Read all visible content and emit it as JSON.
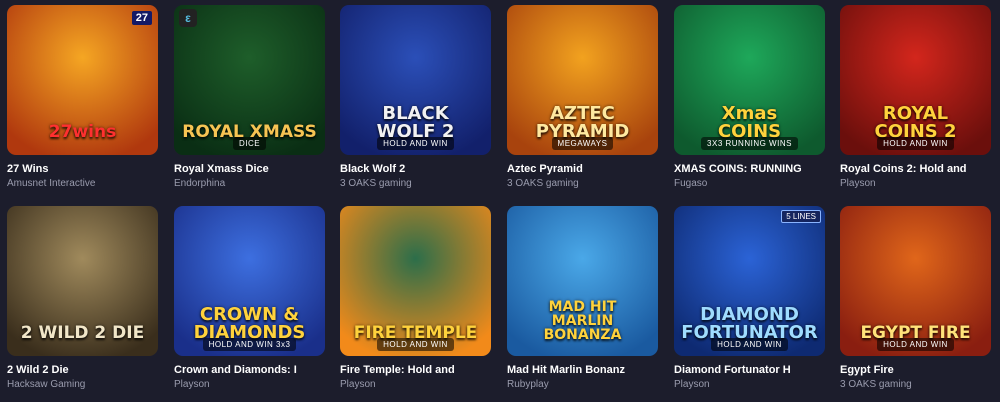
{
  "games": [
    {
      "id": "27wins",
      "title": "27 Wins",
      "provider": "Amusnet Interactive",
      "logo": "27wins",
      "sub": "",
      "badge": "27",
      "colors": [
        "#f5a623",
        "#b0380e"
      ],
      "logo_color": "#ff3030"
    },
    {
      "id": "royal-xmass-dice",
      "title": "Royal Xmass Dice",
      "provider": "Endorphina",
      "logo": "ROYAL XMASS",
      "sub": "DICE",
      "colors": [
        "#1e5e2a",
        "#0a2e14"
      ],
      "logo_color": "#f6c453"
    },
    {
      "id": "black-wolf-2",
      "title": "Black Wolf 2",
      "provider": "3 OAKS gaming",
      "logo": "BLACK\nWOLF 2",
      "sub": "HOLD AND WIN",
      "colors": [
        "#2b4fb8",
        "#12206b"
      ],
      "logo_color": "#f2f2f2"
    },
    {
      "id": "aztec-pyramid",
      "title": "Aztec Pyramid",
      "provider": "3 OAKS gaming",
      "logo": "AZTEC\nPYRAMID",
      "sub": "MEGAWAYS",
      "colors": [
        "#f2a21f",
        "#a8430d"
      ],
      "logo_color": "#ffe9a0"
    },
    {
      "id": "xmas-coins",
      "title": "XMAS COINS: RUNNING",
      "provider": "Fugaso",
      "logo": "Xmas\nCOINS",
      "sub": "3X3 RUNNING WINS",
      "colors": [
        "#1ea85a",
        "#0e5a2e"
      ],
      "logo_color": "#ffd23c"
    },
    {
      "id": "royal-coins-2",
      "title": "Royal Coins 2: Hold and",
      "provider": "Playson",
      "logo": "ROYAL\nCOINS 2",
      "sub": "HOLD AND WIN",
      "colors": [
        "#d3261c",
        "#6b0f0c"
      ],
      "logo_color": "#ffd23c"
    },
    {
      "id": "2-wild-2-die",
      "title": "2 Wild 2 Die",
      "provider": "Hacksaw Gaming",
      "logo": "2 WILD 2 DIE",
      "sub": "",
      "colors": [
        "#a08a5c",
        "#3a2e1c"
      ],
      "logo_color": "#f1e6c8"
    },
    {
      "id": "crown-and-diamonds",
      "title": "Crown and Diamonds: I",
      "provider": "Playson",
      "logo": "CROWN &\nDIAMONDS",
      "sub": "HOLD AND WIN 3x3",
      "colors": [
        "#3d6fe0",
        "#1a2f8a"
      ],
      "logo_color": "#ffd23c"
    },
    {
      "id": "fire-temple",
      "title": "Fire Temple: Hold and",
      "provider": "Playson",
      "logo": "FIRE TEMPLE",
      "sub": "HOLD AND WIN",
      "colors": [
        "#2c6e4a",
        "#f28a1a"
      ],
      "logo_color": "#ffd23c"
    },
    {
      "id": "mad-hit-marlin-bonanza",
      "title": "Mad Hit Marlin Bonanz",
      "provider": "Rubyplay",
      "logo": "MAD HIT\nMARLIN\nBONANZA",
      "sub": "",
      "colors": [
        "#4aa8e8",
        "#1a5aa0"
      ],
      "logo_color": "#ffd23c"
    },
    {
      "id": "diamond-fortunator",
      "title": "Diamond Fortunator H",
      "provider": "Playson",
      "logo": "DIAMOND\nFORTUNATOR",
      "sub": "HOLD AND WIN",
      "badge": "5 LINES",
      "colors": [
        "#2b63d6",
        "#0e2a72"
      ],
      "logo_color": "#9fdcff"
    },
    {
      "id": "egypt-fire",
      "title": "Egypt Fire",
      "provider": "3 OAKS gaming",
      "logo": "EGYPT FIRE",
      "sub": "HOLD AND WIN",
      "colors": [
        "#e0661a",
        "#8a1e10"
      ],
      "logo_color": "#ffe27a"
    }
  ]
}
